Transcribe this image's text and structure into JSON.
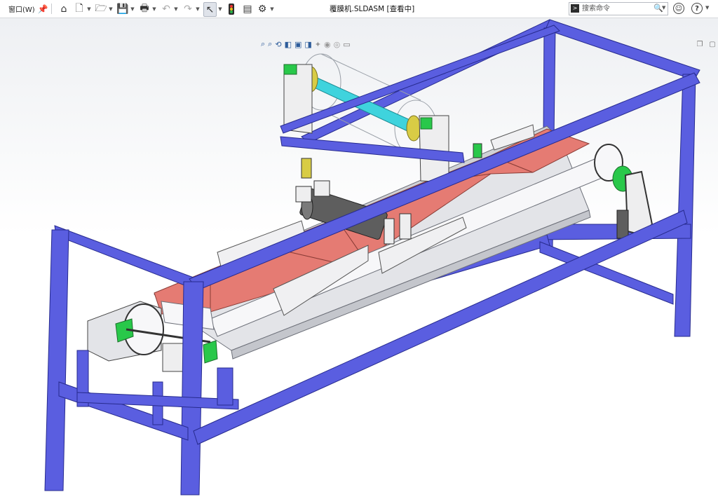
{
  "menu": {
    "window_label": "窗口(W)"
  },
  "document": {
    "title": "覆膜机.SLDASM [查看中]"
  },
  "search": {
    "placeholder": "搜索命令"
  },
  "toolbar": {
    "icons": [
      "pin-icon",
      "home-icon",
      "new-document-icon",
      "open-icon",
      "save-icon",
      "print-icon",
      "undo-icon",
      "redo-icon",
      "select-arrow-icon",
      "traffic-light-icon",
      "file-properties-icon",
      "gear-icon"
    ]
  },
  "heads_up_toolbar": {
    "icons": [
      "zoom-to-fit-icon",
      "zoom-to-area-icon",
      "previous-view-icon",
      "section-view-icon",
      "view-orientation-icon",
      "display-style-icon",
      "hide-show-icon",
      "edit-appearance-icon",
      "apply-scene-icon",
      "view-settings-icon"
    ]
  },
  "colors": {
    "frame": "#5a5ee0",
    "frame_edge": "#272b8e",
    "belt": "#e57b73",
    "roller": "#3fd3dd",
    "sheet_metal": "#dfe0e4",
    "green_part": "#29c84a",
    "yellow_part": "#d8cc45",
    "motor": "#5e5e5e"
  }
}
